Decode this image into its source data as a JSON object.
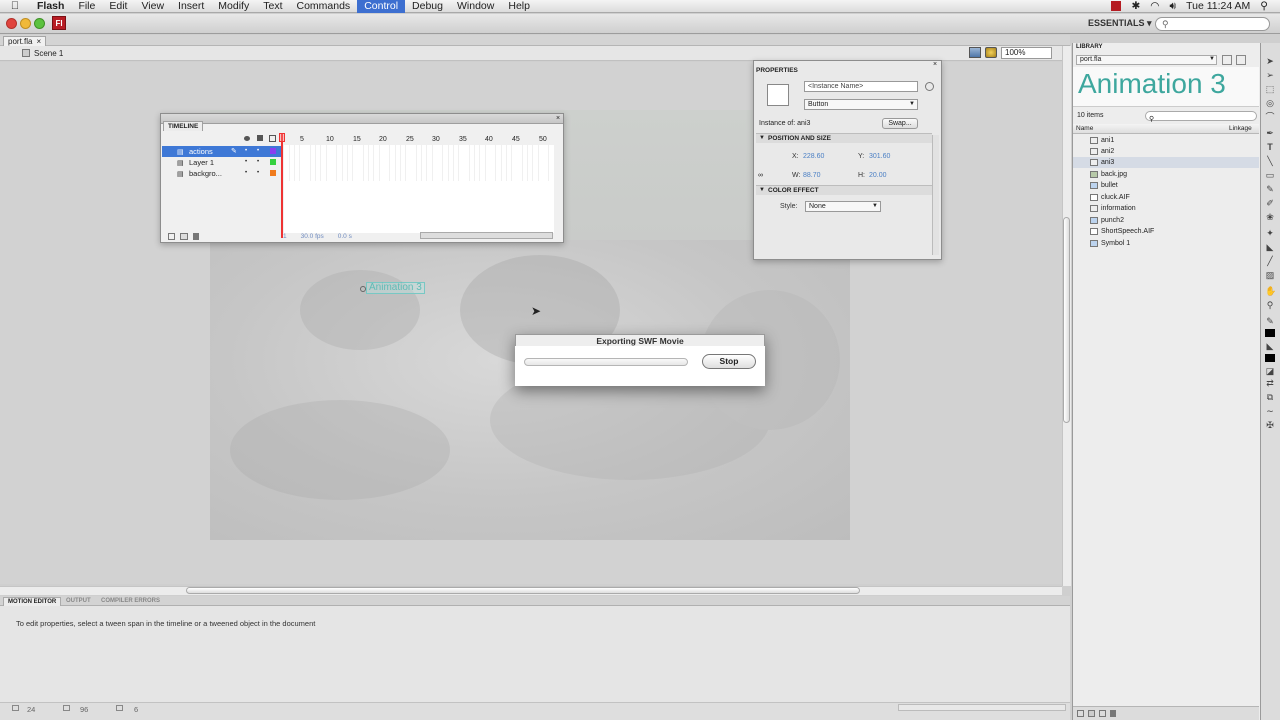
{
  "menubar": {
    "app": "Flash",
    "items": [
      "File",
      "Edit",
      "View",
      "Insert",
      "Modify",
      "Text",
      "Commands",
      "Control",
      "Debug",
      "Window",
      "Help"
    ],
    "active": "Control",
    "clock": "Tue 11:24 AM"
  },
  "toolbar": {
    "app_logo": "Fl",
    "workspace": "ESSENTIALS ▾"
  },
  "document": {
    "tab": "port.fla",
    "tab_close": "×",
    "scene": "Scene 1",
    "zoom": "100%"
  },
  "stage": {
    "instance_label": "Animation 3"
  },
  "timeline": {
    "title": "TIMELINE",
    "layers": [
      {
        "name": "actions",
        "color": "#8a3ff0",
        "selected": true
      },
      {
        "name": "Layer 1",
        "color": "#35d13f",
        "selected": false
      },
      {
        "name": "backgro...",
        "color": "#f07b1d",
        "selected": false
      }
    ],
    "frame_numbers": [
      "5",
      "10",
      "15",
      "20",
      "25",
      "30",
      "35",
      "40",
      "45",
      "50"
    ],
    "status_frame": "1",
    "status_fps": "30.0 fps",
    "status_time": "0.0 s"
  },
  "properties": {
    "title": "PROPERTIES",
    "instance_name_placeholder": "<Instance Name>",
    "instance_type": "Button",
    "instance_of_label": "Instance of:",
    "instance_of_value": "ani3",
    "swap_label": "Swap...",
    "position_section": "POSITION AND SIZE",
    "x_label": "X:",
    "x_value": "228.60",
    "y_label": "Y:",
    "y_value": "301.60",
    "w_label": "W:",
    "w_value": "88.70",
    "h_label": "H:",
    "h_value": "20.00",
    "color_section": "COLOR EFFECT",
    "style_label": "Style:",
    "style_value": "None"
  },
  "export_dialog": {
    "title": "Exporting SWF Movie",
    "stop_label": "Stop",
    "progress": 0
  },
  "motion_editor": {
    "tabs": [
      "MOTION EDITOR",
      "OUTPUT",
      "COMPILER ERRORS"
    ],
    "message": "To edit properties, select a tween span in the timeline or a tweened object in the document",
    "status_values": [
      "24",
      "96",
      "6"
    ]
  },
  "library": {
    "title": "LIBRARY",
    "file": "port.fla",
    "preview": "Animation 3",
    "count": "10 items",
    "col_name": "Name",
    "col_linkage": "Linkage",
    "items": [
      {
        "name": "ani1",
        "selected": false
      },
      {
        "name": "ani2",
        "selected": false
      },
      {
        "name": "ani3",
        "selected": true
      },
      {
        "name": "back.jpg",
        "selected": false
      },
      {
        "name": "bullet",
        "selected": false
      },
      {
        "name": "cluck.AIF",
        "selected": false
      },
      {
        "name": "information",
        "selected": false
      },
      {
        "name": "punch2",
        "selected": false
      },
      {
        "name": "ShortSpeech.AIF",
        "selected": false
      },
      {
        "name": "Symbol 1",
        "selected": false
      }
    ]
  }
}
